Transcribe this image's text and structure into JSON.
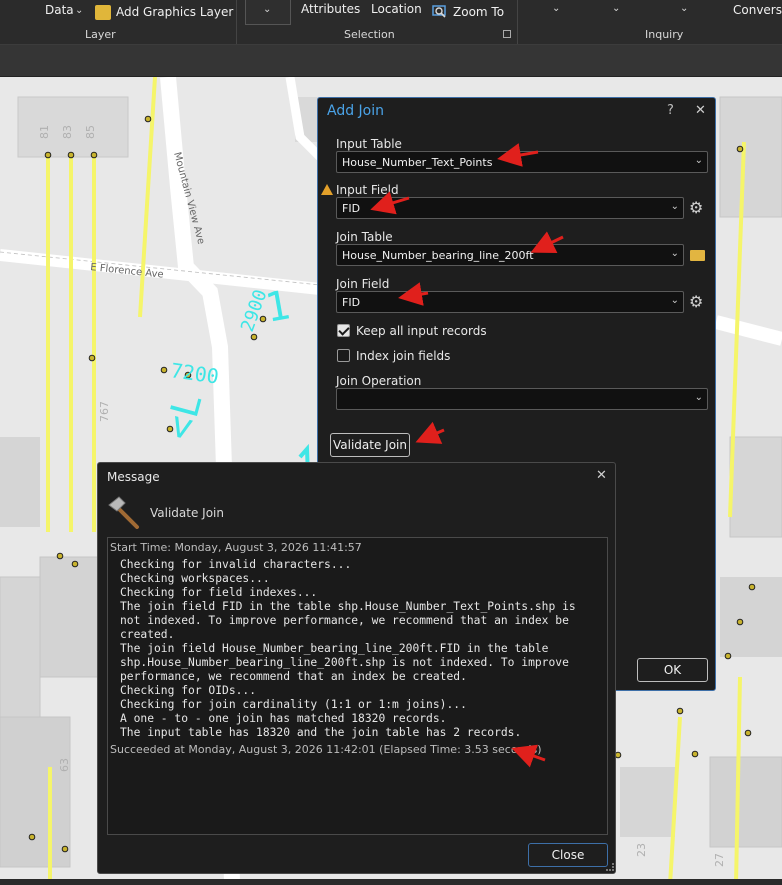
{
  "ribbon": {
    "data_label": "Data",
    "add_graphics_layer": "Add Graphics Layer",
    "attributes": "Attributes",
    "location": "Location",
    "zoom_to": "Zoom To",
    "conversion": "Conversi",
    "groups": {
      "layer": "Layer",
      "selection": "Selection",
      "inquiry": "Inquiry"
    }
  },
  "map": {
    "street_mountain_view": "Mountain View Ave",
    "street_florence": "E Florence Ave",
    "annotations": [
      "81",
      "83",
      "85",
      "2900",
      "7200",
      "767",
      "63",
      "23",
      "27"
    ]
  },
  "add_join": {
    "title": "Add Join",
    "help": "?",
    "close": "✕",
    "input_table_label": "Input Table",
    "input_table_value": "House_Number_Text_Points",
    "input_field_label": "Input Field",
    "input_field_value": "FID",
    "join_table_label": "Join Table",
    "join_table_value": "House_Number_bearing_line_200ft",
    "join_field_label": "Join Field",
    "join_field_value": "FID",
    "keep_all_label": "Keep all input records",
    "keep_all_checked": true,
    "index_join_label": "Index join fields",
    "index_join_checked": false,
    "join_operation_label": "Join Operation",
    "join_operation_value": "",
    "validate_button": "Validate Join",
    "ok_button": "OK"
  },
  "message": {
    "title": "Message",
    "close": "✕",
    "subtitle": "Validate Join",
    "start_time": "Start Time: Monday, August 3, 2026 11:41:57",
    "log_lines": [
      "Checking for invalid characters...",
      "Checking workspaces...",
      "Checking for field indexes...",
      "The join field FID in the table shp.House_Number_Text_Points.shp is",
      "not indexed. To improve performance, we recommend that an index be",
      "created.",
      "The join field House_Number_bearing_line_200ft.FID in the table",
      "shp.House_Number_bearing_line_200ft.shp is not indexed. To improve",
      "performance, we recommend that an index be created.",
      "Checking for OIDs...",
      "Checking for join cardinality (1:1 or 1:m joins)...",
      "A one - to - one join has matched 18320 records.",
      "The input table has 18320 and the join table has 2 records."
    ],
    "succeeded": "Succeeded at Monday, August 3, 2026 11:42:01 (Elapsed Time: 3.53 seconds)",
    "close_button": "Close"
  },
  "colors": {
    "accent": "#4aa3e8",
    "annotation_red": "#e0201c",
    "feature_yellow": "#f5f56a",
    "label_cyan": "#3ee6e6"
  }
}
